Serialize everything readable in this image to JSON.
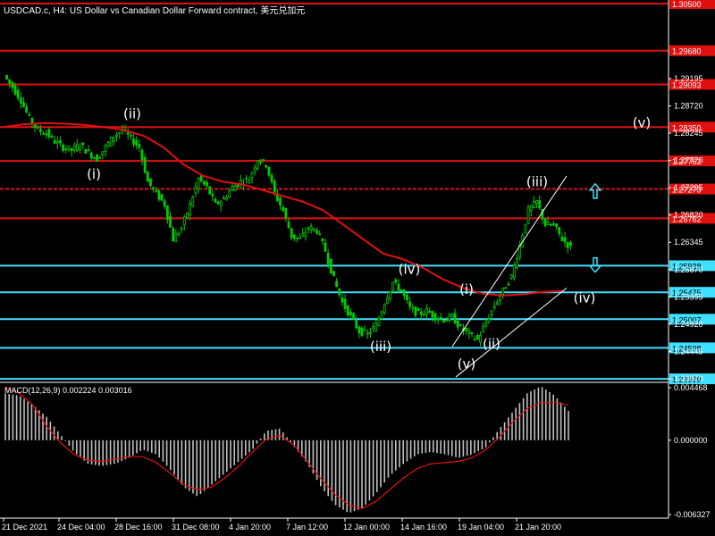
{
  "window_title": "USDCAD.c, H4:  US Dollar vs Canadian Dollar Forward contract, 美元兑加元",
  "macd_title": "MACD(12,26,9) 0.002224 0.003016",
  "colors": {
    "background": "#000000",
    "candles": "#00cc00",
    "moving_average": "#e01010",
    "red_levels": "#e01010",
    "cyan_levels": "#40e0ff",
    "macd_histogram": "#c0c0c0",
    "macd_signal": "#e01010",
    "wave_labels": "#ffffff",
    "up_arrow": "#40e0ff",
    "down_arrow": "#40e0ff"
  },
  "price_axis": {
    "ticks": [
      "1.29195",
      "1.28720",
      "1.28245",
      "1.27770",
      "1.27295",
      "1.26820",
      "1.26345",
      "1.25870",
      "1.25395",
      "1.24920",
      "1.24445",
      "1.23970"
    ],
    "ylim": [
      1.2397,
      1.305
    ]
  },
  "level_lines": [
    {
      "price": "1.30500",
      "color": "red",
      "style": "solid"
    },
    {
      "price": "1.29680",
      "color": "red",
      "style": "solid"
    },
    {
      "price": "1.29093",
      "color": "red",
      "style": "solid"
    },
    {
      "price": "1.28350",
      "color": "red",
      "style": "solid"
    },
    {
      "price": "1.27762",
      "color": "red",
      "style": "solid"
    },
    {
      "price": "1.27273",
      "color": "red",
      "style": "dashed"
    },
    {
      "price": "1.26762",
      "color": "red",
      "style": "solid"
    },
    {
      "price": "1.25938",
      "color": "cyan",
      "style": "solid"
    },
    {
      "price": "1.25475",
      "color": "cyan",
      "style": "solid"
    },
    {
      "price": "1.25007",
      "color": "cyan",
      "style": "solid"
    },
    {
      "price": "1.24508",
      "color": "cyan",
      "style": "solid"
    },
    {
      "price": "1.23969",
      "color": "cyan",
      "style": "solid"
    }
  ],
  "time_axis": {
    "labels": [
      "21 Dec 2021",
      "24 Dec 04:00",
      "28 Dec 16:00",
      "31 Dec 08:00",
      "4 Jan 20:00",
      "7 Jan 12:00",
      "12 Jan 00:00",
      "14 Jan 16:00",
      "19 Jan 04:00",
      "21 Jan 20:00"
    ]
  },
  "macd_axis": {
    "ticks": [
      "0.004468",
      "0.000000",
      "-0.006327"
    ]
  },
  "chart_data": {
    "type": "candlestick",
    "symbol": "USDCAD.c",
    "timeframe": "H4",
    "series": [
      {
        "name": "close_path",
        "values": [
          1.2925,
          1.2905,
          1.2882,
          1.285,
          1.283,
          1.2825,
          1.281,
          1.28,
          1.2795,
          1.2805,
          1.279,
          1.278,
          1.28,
          1.282,
          1.283,
          1.2815,
          1.28,
          1.274,
          1.272,
          1.27,
          1.264,
          1.266,
          1.27,
          1.2745,
          1.273,
          1.27,
          1.271,
          1.273,
          1.274,
          1.2745,
          1.278,
          1.277,
          1.272,
          1.269,
          1.2645,
          1.264,
          1.266,
          1.2655,
          1.262,
          1.257,
          1.253,
          1.2505,
          1.248,
          1.2475,
          1.249,
          1.253,
          1.2565,
          1.255,
          1.252,
          1.251,
          1.2515,
          1.2505,
          1.25,
          1.2505,
          1.2485,
          1.2475,
          1.2465,
          1.2495,
          1.2525,
          1.255,
          1.2575,
          1.263,
          1.269,
          1.2705,
          1.2665,
          1.2665,
          1.264,
          1.2625
        ]
      },
      {
        "name": "moving_average",
        "values": [
          1.2835,
          1.284,
          1.2842,
          1.2841,
          1.2839,
          1.2835,
          1.283,
          1.282,
          1.28,
          1.277,
          1.275,
          1.274,
          1.2735,
          1.2725,
          1.2715,
          1.2705,
          1.269,
          1.2665,
          1.264,
          1.2615,
          1.2605,
          1.259,
          1.257,
          1.2555,
          1.2545,
          1.2542,
          1.2544,
          1.2548,
          1.255
        ]
      },
      {
        "name": "macd_histogram",
        "values": [
          0.004,
          0.0038,
          0.003,
          0.002,
          0.0005,
          -0.001,
          -0.002,
          -0.0022,
          -0.002,
          -0.0015,
          -0.0008,
          -0.0012,
          -0.0025,
          -0.004,
          -0.0048,
          -0.0038,
          -0.0028,
          -0.0018,
          -0.0008,
          0.0008,
          0.001,
          -0.0005,
          -0.002,
          -0.004,
          -0.0055,
          -0.0062,
          -0.0058,
          -0.0045,
          -0.003,
          -0.002,
          -0.0012,
          -0.001,
          -0.0012,
          -0.0015,
          -0.0012,
          -0.0006,
          0.001,
          0.0025,
          0.004,
          0.0046,
          0.0038,
          0.0025
        ]
      },
      {
        "name": "macd_signal",
        "values": [
          0.0045,
          0.004,
          0.003,
          0.0012,
          -0.0002,
          -0.0012,
          -0.0017,
          -0.0018,
          -0.0016,
          -0.0014,
          -0.0014,
          -0.0019,
          -0.0028,
          -0.0038,
          -0.0042,
          -0.004,
          -0.0032,
          -0.0022,
          -0.001,
          0.0001,
          0.0004,
          -0.0004,
          -0.0018,
          -0.0033,
          -0.0046,
          -0.0055,
          -0.0058,
          -0.0052,
          -0.0042,
          -0.0032,
          -0.0024,
          -0.002,
          -0.0019,
          -0.0018,
          -0.0015,
          -0.0008,
          0.0003,
          0.0016,
          0.0027,
          0.0032,
          0.0032,
          0.003
        ]
      }
    ],
    "wave_labels": [
      {
        "text": "(i)",
        "price": 1.2745
      },
      {
        "text": "(ii)",
        "price": 1.285
      },
      {
        "text": "(iii)",
        "price": 1.2445
      },
      {
        "text": "(iv)",
        "price": 1.258
      },
      {
        "text": "(i)",
        "price": 1.2545
      },
      {
        "text": "(v)",
        "price": 1.2415
      },
      {
        "text": "(ii)",
        "price": 1.245
      },
      {
        "text": "(iii)",
        "price": 1.2732
      },
      {
        "text": "(iv)",
        "price": 1.253
      },
      {
        "text": "(v)",
        "price": 1.2835
      }
    ]
  }
}
